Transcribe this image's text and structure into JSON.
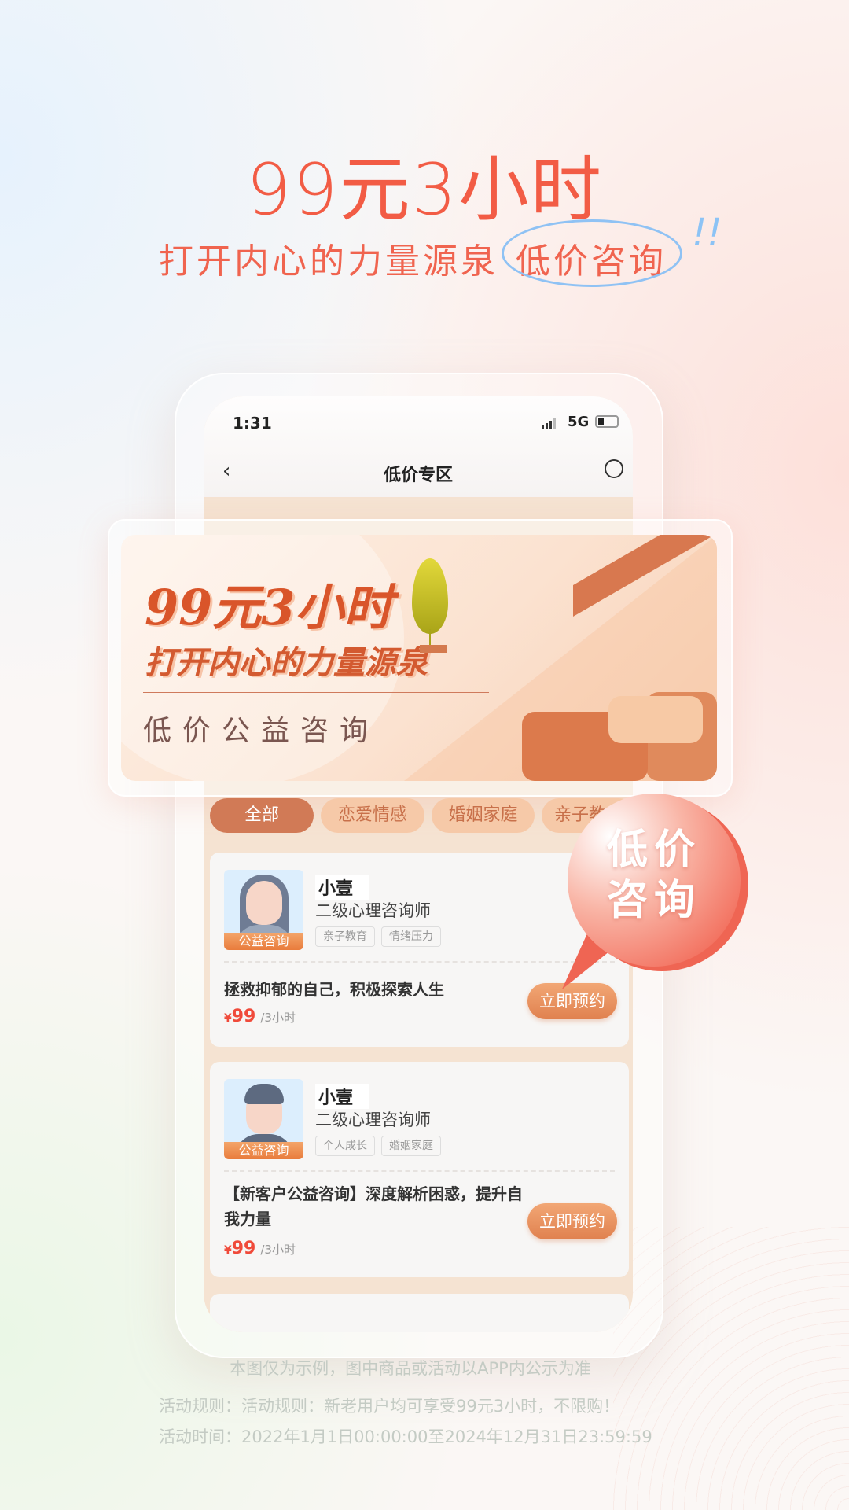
{
  "hero": {
    "headline": "99元3小时",
    "subtitle": "打开内心的力量源泉",
    "highlight": "低价咨询",
    "exclaim": "!!"
  },
  "phone": {
    "status": {
      "time": "1:31",
      "network": "5G",
      "battery_level": 0.25
    },
    "nav": {
      "back_icon": "chevron-left-icon",
      "title": "低价专区",
      "share_icon": "share-icon"
    },
    "banner": {
      "line1": "99元3小时",
      "line2": "打开内心的力量源泉",
      "line3": "低价公益咨询"
    },
    "tabs": [
      {
        "label": "全部",
        "active": true
      },
      {
        "label": "恋爱情感"
      },
      {
        "label": "婚姻家庭"
      },
      {
        "label": "亲子教育"
      }
    ],
    "cards": [
      {
        "badge": "公益咨询",
        "name": "小壹",
        "role": "二级心理咨询师",
        "tags": [
          "亲子教育",
          "情绪压力"
        ],
        "desc": "拯救抑郁的自己，积极探索人生",
        "currency": "¥",
        "price": "99",
        "unit": "/3小时",
        "button": "立即预约"
      },
      {
        "badge": "公益咨询",
        "name": "小壹",
        "role": "二级心理咨询师",
        "tags": [
          "个人成长",
          "婚姻家庭"
        ],
        "desc": "【新客户公益咨询】深度解析困惑，提升自我力量",
        "currency": "¥",
        "price": "99",
        "unit": "/3小时",
        "button": "立即预约"
      }
    ]
  },
  "bubble": {
    "text": "低价咨询"
  },
  "footer": {
    "disclaimer": "本图仅为示例，图中商品或活动以APP内公示为准",
    "rules": "活动规则：活动规则：新老用户均可享受99元3小时，不限购！",
    "time": "活动时间：2022年1月1日00:00:00至2024年12月31日23:59:59"
  },
  "colors": {
    "accent": "#f25c45",
    "tab_active": "#d17a56",
    "button": "#e0814f",
    "price": "#f04a3a",
    "circle": "#8fc2f4"
  }
}
